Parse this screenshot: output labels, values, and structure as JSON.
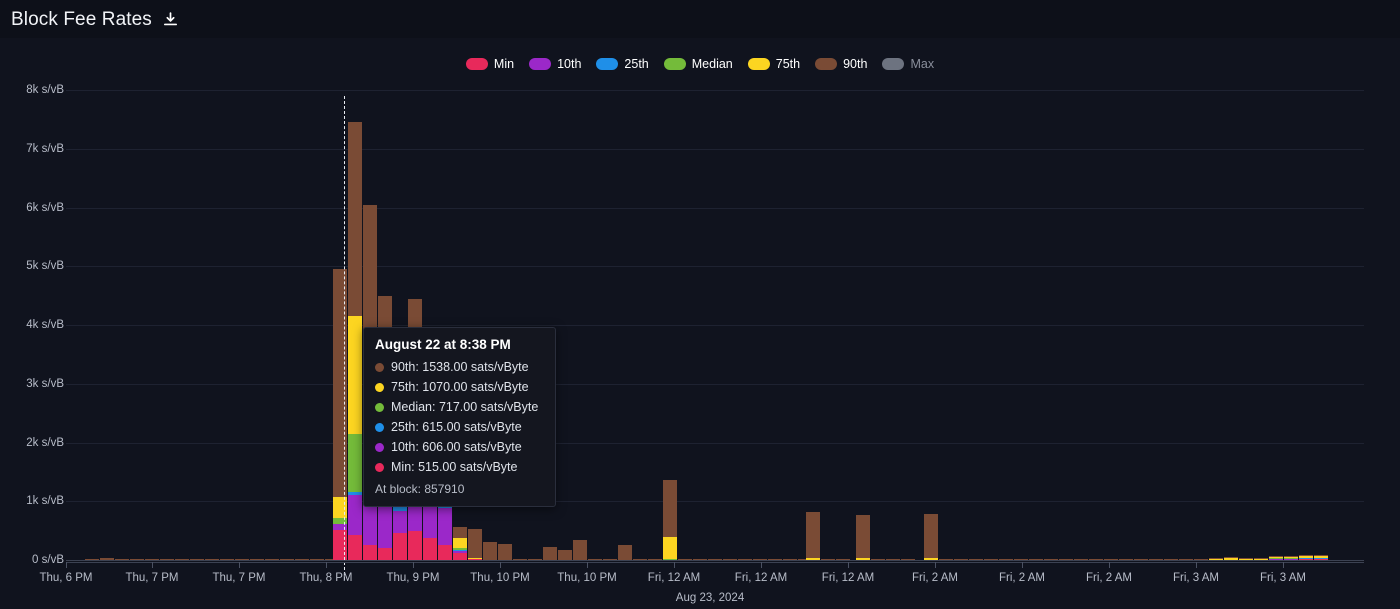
{
  "header": {
    "title": "Block Fee Rates",
    "download_icon": "download-icon"
  },
  "legend": {
    "items": [
      {
        "label": "Min",
        "color": "#e8295b",
        "disabled": false
      },
      {
        "label": "10th",
        "color": "#9b28c9",
        "disabled": false
      },
      {
        "label": "25th",
        "color": "#1f8fe8",
        "disabled": false
      },
      {
        "label": "Median",
        "color": "#74bb3a",
        "disabled": false
      },
      {
        "label": "75th",
        "color": "#fcd521",
        "disabled": false
      },
      {
        "label": "90th",
        "color": "#7a4b35",
        "disabled": false
      },
      {
        "label": "Max",
        "color": "#6d7380",
        "disabled": true
      }
    ]
  },
  "tooltip": {
    "title": "August 22 at 8:38 PM",
    "rows": [
      {
        "label": "90th",
        "value": "1538.00",
        "unit": "sats/vByte",
        "color": "#7a4b35",
        "text": "90th: 1538.00 sats/vByte"
      },
      {
        "label": "75th",
        "value": "1070.00",
        "unit": "sats/vByte",
        "color": "#fcd521",
        "text": "75th: 1070.00 sats/vByte"
      },
      {
        "label": "Median",
        "value": "717.00",
        "unit": "sats/vByte",
        "color": "#74bb3a",
        "text": "Median: 717.00 sats/vByte"
      },
      {
        "label": "25th",
        "value": "615.00",
        "unit": "sats/vByte",
        "color": "#1f8fe8",
        "text": "25th: 615.00 sats/vByte"
      },
      {
        "label": "10th",
        "value": "606.00",
        "unit": "sats/vByte",
        "color": "#9b28c9",
        "text": "10th: 606.00 sats/vByte"
      },
      {
        "label": "Min",
        "value": "515.00",
        "unit": "sats/vByte",
        "color": "#e8295b",
        "text": "Min: 515.00 sats/vByte"
      }
    ],
    "footer": "At block: 857910"
  },
  "chart_data": {
    "type": "bar",
    "stacked": true,
    "title": "Block Fee Rates",
    "xlabel": "",
    "ylabel": "sats/vByte",
    "ylim": [
      0,
      8000
    ],
    "grid": true,
    "legend_position": "top-center",
    "y_ticks": [
      {
        "value": 8000,
        "label": "8k s/vB"
      },
      {
        "value": 7000,
        "label": "7k s/vB"
      },
      {
        "value": 6000,
        "label": "6k s/vB"
      },
      {
        "value": 5000,
        "label": "5k s/vB"
      },
      {
        "value": 4000,
        "label": "4k s/vB"
      },
      {
        "value": 3000,
        "label": "3k s/vB"
      },
      {
        "value": 2000,
        "label": "2k s/vB"
      },
      {
        "value": 1000,
        "label": "1k s/vB"
      },
      {
        "value": 0,
        "label": "0 s/vB"
      }
    ],
    "x_ticks": [
      {
        "label": "Thu, 6 PM",
        "x": 66
      },
      {
        "label": "Thu, 7 PM",
        "x": 152
      },
      {
        "label": "Thu, 7 PM",
        "x": 239
      },
      {
        "label": "Thu, 8 PM",
        "x": 326
      },
      {
        "label": "Thu, 9 PM",
        "x": 413
      },
      {
        "label": "Thu, 10 PM",
        "x": 500
      },
      {
        "label": "Thu, 10 PM",
        "x": 587
      },
      {
        "label": "Fri, 12 AM",
        "x": 674
      },
      {
        "label": "Fri, 12 AM",
        "x": 761
      },
      {
        "label": "Fri, 12 AM",
        "x": 848
      },
      {
        "label": "Fri, 2 AM",
        "x": 935
      },
      {
        "label": "Fri, 2 AM",
        "x": 1022
      },
      {
        "label": "Fri, 2 AM",
        "x": 1109
      },
      {
        "label": "Fri, 3 AM",
        "x": 1196
      },
      {
        "label": "Fri, 3 AM",
        "x": 1283
      }
    ],
    "x_sublabel": {
      "label": "Aug 23, 2024",
      "x": 710
    },
    "series": [
      {
        "name": "Min",
        "color": "#e8295b"
      },
      {
        "name": "10th",
        "color": "#9b28c9"
      },
      {
        "name": "25th",
        "color": "#1f8fe8"
      },
      {
        "name": "Median",
        "color": "#74bb3a"
      },
      {
        "name": "75th",
        "color": "#fcd521"
      },
      {
        "name": "90th",
        "color": "#7a4b35"
      }
    ],
    "highlight_x": 344,
    "highlight_index": 20,
    "bars": [
      {
        "x": 70,
        "min": 0,
        "p10": 0,
        "p25": 0,
        "median": 0,
        "p75": 0,
        "p90": 0,
        "max": 22
      },
      {
        "x": 85,
        "min": 0,
        "p10": 0,
        "p25": 0,
        "median": 0,
        "p75": 0,
        "p90": 18,
        "max": 28
      },
      {
        "x": 100,
        "min": 0,
        "p10": 0,
        "p25": 0,
        "median": 0,
        "p75": 0,
        "p90": 32,
        "max": 40
      },
      {
        "x": 115,
        "min": 0,
        "p10": 0,
        "p25": 0,
        "median": 0,
        "p75": 0,
        "p90": 12,
        "max": 20
      },
      {
        "x": 130,
        "min": 0,
        "p10": 0,
        "p25": 0,
        "median": 0,
        "p75": 0,
        "p90": 10,
        "max": 18
      },
      {
        "x": 145,
        "min": 0,
        "p10": 0,
        "p25": 0,
        "median": 0,
        "p75": 0,
        "p90": 9,
        "max": 16
      },
      {
        "x": 160,
        "min": 0,
        "p10": 0,
        "p25": 0,
        "median": 0,
        "p75": 0,
        "p90": 8,
        "max": 14
      },
      {
        "x": 175,
        "min": 0,
        "p10": 0,
        "p25": 0,
        "median": 0,
        "p75": 0,
        "p90": 8,
        "max": 14
      },
      {
        "x": 190,
        "min": 0,
        "p10": 0,
        "p25": 0,
        "median": 0,
        "p75": 0,
        "p90": 9,
        "max": 15
      },
      {
        "x": 205,
        "min": 0,
        "p10": 0,
        "p25": 0,
        "median": 0,
        "p75": 0,
        "p90": 8,
        "max": 14
      },
      {
        "x": 220,
        "min": 0,
        "p10": 0,
        "p25": 0,
        "median": 0,
        "p75": 0,
        "p90": 7,
        "max": 13
      },
      {
        "x": 235,
        "min": 0,
        "p10": 0,
        "p25": 0,
        "median": 0,
        "p75": 0,
        "p90": 8,
        "max": 14
      },
      {
        "x": 250,
        "min": 0,
        "p10": 0,
        "p25": 0,
        "median": 0,
        "p75": 0,
        "p90": 9,
        "max": 15
      },
      {
        "x": 265,
        "min": 0,
        "p10": 0,
        "p25": 0,
        "median": 0,
        "p75": 0,
        "p90": 8,
        "max": 14
      },
      {
        "x": 280,
        "min": 0,
        "p10": 0,
        "p25": 0,
        "median": 0,
        "p75": 0,
        "p90": 10,
        "max": 16
      },
      {
        "x": 295,
        "min": 0,
        "p10": 0,
        "p25": 0,
        "median": 0,
        "p75": 0,
        "p90": 22,
        "max": 30
      },
      {
        "x": 310,
        "min": 0,
        "p10": 0,
        "p25": 0,
        "median": 0,
        "p75": 0,
        "p90": 24,
        "max": 32
      },
      {
        "x": 325,
        "min": 0,
        "p10": 0,
        "p25": 0,
        "median": 0,
        "p75": 0,
        "p90": 18,
        "max": 26
      },
      {
        "x": 333,
        "min": 515,
        "p10": 606,
        "p25": 615,
        "median": 717,
        "p75": 1070,
        "p90": 4950,
        "max": 4950
      },
      {
        "x": 348,
        "min": 430,
        "p10": 1100,
        "p25": 1160,
        "median": 2150,
        "p75": 4150,
        "p90": 7450,
        "max": 7450
      },
      {
        "x": 363,
        "min": 250,
        "p10": 1050,
        "p25": 1080,
        "median": 1100,
        "p75": 1130,
        "p90": 6050,
        "max": 6050
      },
      {
        "x": 378,
        "min": 200,
        "p10": 950,
        "p25": 980,
        "median": 1000,
        "p75": 1020,
        "p90": 4500,
        "max": 4500
      },
      {
        "x": 393,
        "min": 460,
        "p10": 830,
        "p25": 1060,
        "median": 1080,
        "p75": 1100,
        "p90": 1130,
        "max": 1130
      },
      {
        "x": 408,
        "min": 500,
        "p10": 900,
        "p25": 1080,
        "median": 1100,
        "p75": 1120,
        "p90": 4450,
        "max": 4450
      },
      {
        "x": 423,
        "min": 370,
        "p10": 1020,
        "p25": 1060,
        "median": 1080,
        "p75": 1100,
        "p90": 1120,
        "max": 1120
      },
      {
        "x": 438,
        "min": 260,
        "p10": 880,
        "p25": 980,
        "median": 1000,
        "p75": 1020,
        "p90": 1040,
        "max": 1040
      },
      {
        "x": 453,
        "min": 120,
        "p10": 150,
        "p25": 170,
        "median": 200,
        "p75": 380,
        "p90": 560,
        "max": 560
      },
      {
        "x": 468,
        "min": 10,
        "p10": 15,
        "p25": 20,
        "median": 25,
        "p75": 30,
        "p90": 530,
        "max": 530
      },
      {
        "x": 483,
        "min": 0,
        "p10": 0,
        "p25": 0,
        "median": 0,
        "p75": 5,
        "p90": 300,
        "max": 300
      },
      {
        "x": 498,
        "min": 0,
        "p10": 0,
        "p25": 0,
        "median": 0,
        "p75": 5,
        "p90": 270,
        "max": 270
      },
      {
        "x": 513,
        "min": 0,
        "p10": 0,
        "p25": 0,
        "median": 0,
        "p75": 5,
        "p90": 15,
        "max": 20
      },
      {
        "x": 528,
        "min": 0,
        "p10": 0,
        "p25": 0,
        "median": 0,
        "p75": 5,
        "p90": 14,
        "max": 18
      },
      {
        "x": 543,
        "min": 0,
        "p10": 0,
        "p25": 0,
        "median": 0,
        "p75": 5,
        "p90": 225,
        "max": 225
      },
      {
        "x": 558,
        "min": 0,
        "p10": 0,
        "p25": 0,
        "median": 0,
        "p75": 5,
        "p90": 170,
        "max": 170
      },
      {
        "x": 573,
        "min": 0,
        "p10": 0,
        "p25": 0,
        "median": 0,
        "p75": 5,
        "p90": 340,
        "max": 340
      },
      {
        "x": 588,
        "min": 0,
        "p10": 0,
        "p25": 0,
        "median": 0,
        "p75": 5,
        "p90": 16,
        "max": 20
      },
      {
        "x": 603,
        "min": 0,
        "p10": 0,
        "p25": 0,
        "median": 0,
        "p75": 5,
        "p90": 14,
        "max": 18
      },
      {
        "x": 618,
        "min": 0,
        "p10": 0,
        "p25": 0,
        "median": 0,
        "p75": 5,
        "p90": 255,
        "max": 255
      },
      {
        "x": 633,
        "min": 0,
        "p10": 0,
        "p25": 0,
        "median": 0,
        "p75": 5,
        "p90": 14,
        "max": 18
      },
      {
        "x": 648,
        "min": 0,
        "p10": 0,
        "p25": 0,
        "median": 0,
        "p75": 5,
        "p90": 13,
        "max": 17
      },
      {
        "x": 663,
        "min": 0,
        "p10": 0,
        "p25": 0,
        "median": 15,
        "p75": 390,
        "p90": 1370,
        "max": 1370
      },
      {
        "x": 678,
        "min": 0,
        "p10": 0,
        "p25": 0,
        "median": 0,
        "p75": 5,
        "p90": 15,
        "max": 20
      },
      {
        "x": 693,
        "min": 0,
        "p10": 0,
        "p25": 0,
        "median": 0,
        "p75": 5,
        "p90": 12,
        "max": 16
      },
      {
        "x": 708,
        "min": 0,
        "p10": 0,
        "p25": 0,
        "median": 0,
        "p75": 5,
        "p90": 11,
        "max": 15
      },
      {
        "x": 723,
        "min": 0,
        "p10": 0,
        "p25": 0,
        "median": 0,
        "p75": 5,
        "p90": 11,
        "max": 15
      },
      {
        "x": 738,
        "min": 0,
        "p10": 0,
        "p25": 0,
        "median": 0,
        "p75": 5,
        "p90": 10,
        "max": 14
      },
      {
        "x": 753,
        "min": 0,
        "p10": 0,
        "p25": 0,
        "median": 0,
        "p75": 5,
        "p90": 12,
        "max": 16
      },
      {
        "x": 768,
        "min": 0,
        "p10": 0,
        "p25": 0,
        "median": 0,
        "p75": 5,
        "p90": 22,
        "max": 28
      },
      {
        "x": 783,
        "min": 0,
        "p10": 0,
        "p25": 0,
        "median": 0,
        "p75": 5,
        "p90": 12,
        "max": 16
      },
      {
        "x": 798,
        "min": 0,
        "p10": 0,
        "p25": 0,
        "median": 0,
        "p75": 5,
        "p90": 11,
        "max": 15
      },
      {
        "x": 806,
        "min": 0,
        "p10": 0,
        "p25": 0,
        "median": 0,
        "p75": 30,
        "p90": 810,
        "max": 810
      },
      {
        "x": 821,
        "min": 0,
        "p10": 0,
        "p25": 0,
        "median": 0,
        "p75": 5,
        "p90": 14,
        "max": 18
      },
      {
        "x": 836,
        "min": 0,
        "p10": 0,
        "p25": 0,
        "median": 0,
        "p75": 5,
        "p90": 12,
        "max": 16
      },
      {
        "x": 856,
        "min": 0,
        "p10": 0,
        "p25": 0,
        "median": 0,
        "p75": 28,
        "p90": 760,
        "max": 760
      },
      {
        "x": 871,
        "min": 0,
        "p10": 0,
        "p25": 0,
        "median": 0,
        "p75": 5,
        "p90": 13,
        "max": 17
      },
      {
        "x": 886,
        "min": 0,
        "p10": 0,
        "p25": 0,
        "median": 0,
        "p75": 5,
        "p90": 12,
        "max": 16
      },
      {
        "x": 901,
        "min": 0,
        "p10": 0,
        "p25": 0,
        "median": 0,
        "p75": 5,
        "p90": 11,
        "max": 15
      },
      {
        "x": 924,
        "min": 0,
        "p10": 0,
        "p25": 0,
        "median": 0,
        "p75": 30,
        "p90": 790,
        "max": 790
      },
      {
        "x": 939,
        "min": 0,
        "p10": 0,
        "p25": 0,
        "median": 0,
        "p75": 5,
        "p90": 12,
        "max": 16
      },
      {
        "x": 954,
        "min": 0,
        "p10": 0,
        "p25": 0,
        "median": 0,
        "p75": 5,
        "p90": 11,
        "max": 15
      },
      {
        "x": 969,
        "min": 0,
        "p10": 0,
        "p25": 0,
        "median": 0,
        "p75": 5,
        "p90": 10,
        "max": 14
      },
      {
        "x": 984,
        "min": 0,
        "p10": 0,
        "p25": 0,
        "median": 0,
        "p75": 5,
        "p90": 10,
        "max": 14
      },
      {
        "x": 999,
        "min": 0,
        "p10": 0,
        "p25": 0,
        "median": 0,
        "p75": 5,
        "p90": 9,
        "max": 13
      },
      {
        "x": 1014,
        "min": 0,
        "p10": 0,
        "p25": 0,
        "median": 0,
        "p75": 5,
        "p90": 9,
        "max": 13
      },
      {
        "x": 1029,
        "min": 0,
        "p10": 0,
        "p25": 0,
        "median": 0,
        "p75": 5,
        "p90": 8,
        "max": 12
      },
      {
        "x": 1044,
        "min": 0,
        "p10": 0,
        "p25": 0,
        "median": 0,
        "p75": 5,
        "p90": 8,
        "max": 12
      },
      {
        "x": 1059,
        "min": 0,
        "p10": 0,
        "p25": 0,
        "median": 0,
        "p75": 5,
        "p90": 8,
        "max": 12
      },
      {
        "x": 1074,
        "min": 0,
        "p10": 0,
        "p25": 0,
        "median": 0,
        "p75": 5,
        "p90": 10,
        "max": 14
      },
      {
        "x": 1089,
        "min": 0,
        "p10": 0,
        "p25": 0,
        "median": 0,
        "p75": 5,
        "p90": 12,
        "max": 16
      },
      {
        "x": 1104,
        "min": 0,
        "p10": 0,
        "p25": 0,
        "median": 0,
        "p75": 5,
        "p90": 12,
        "max": 16
      },
      {
        "x": 1119,
        "min": 0,
        "p10": 0,
        "p25": 0,
        "median": 0,
        "p75": 5,
        "p90": 10,
        "max": 14
      },
      {
        "x": 1134,
        "min": 0,
        "p10": 0,
        "p25": 0,
        "median": 0,
        "p75": 5,
        "p90": 10,
        "max": 14
      },
      {
        "x": 1149,
        "min": 0,
        "p10": 0,
        "p25": 0,
        "median": 0,
        "p75": 6,
        "p90": 22,
        "max": 28
      },
      {
        "x": 1164,
        "min": 0,
        "p10": 0,
        "p25": 0,
        "median": 0,
        "p75": 6,
        "p90": 24,
        "max": 30
      },
      {
        "x": 1179,
        "min": 0,
        "p10": 0,
        "p25": 0,
        "median": 0,
        "p75": 6,
        "p90": 20,
        "max": 26
      },
      {
        "x": 1194,
        "min": 0,
        "p10": 0,
        "p25": 0,
        "median": 0,
        "p75": 6,
        "p90": 20,
        "max": 26
      },
      {
        "x": 1209,
        "min": 0,
        "p10": 0,
        "p25": 0,
        "median": 6,
        "p75": 14,
        "p90": 34,
        "max": 40
      },
      {
        "x": 1224,
        "min": 0,
        "p10": 0,
        "p25": 0,
        "median": 6,
        "p75": 34,
        "p90": 44,
        "max": 50
      },
      {
        "x": 1239,
        "min": 0,
        "p10": 0,
        "p25": 0,
        "median": 6,
        "p75": 14,
        "p90": 30,
        "max": 36
      },
      {
        "x": 1254,
        "min": 0,
        "p10": 0,
        "p25": 0,
        "median": 6,
        "p75": 16,
        "p90": 32,
        "max": 38
      },
      {
        "x": 1269,
        "min": 8,
        "p10": 14,
        "p25": 20,
        "median": 32,
        "p75": 56,
        "p90": 66,
        "max": 72
      },
      {
        "x": 1284,
        "min": 8,
        "p10": 14,
        "p25": 20,
        "median": 30,
        "p75": 54,
        "p90": 64,
        "max": 70
      },
      {
        "x": 1299,
        "min": 10,
        "p10": 18,
        "p25": 26,
        "median": 38,
        "p75": 62,
        "p90": 72,
        "max": 78
      },
      {
        "x": 1314,
        "min": 10,
        "p10": 18,
        "p25": 26,
        "median": 38,
        "p75": 62,
        "p90": 72,
        "max": 78
      }
    ]
  }
}
